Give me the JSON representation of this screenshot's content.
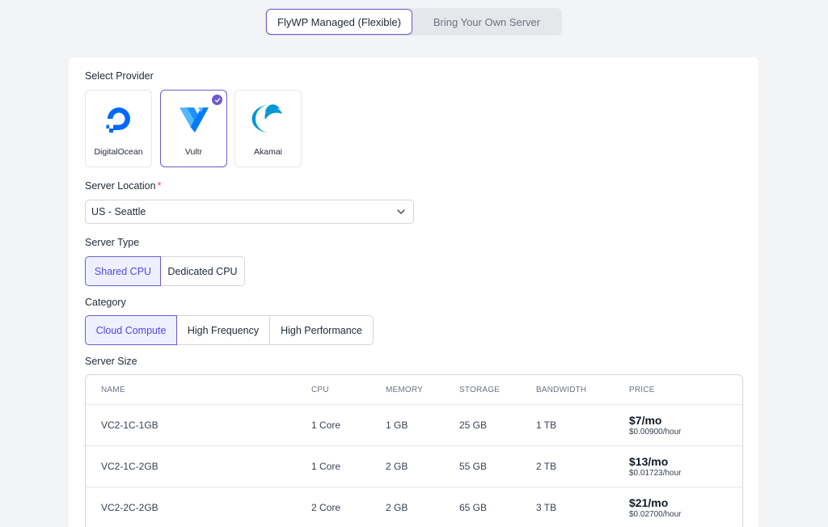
{
  "mode_toggle": {
    "managed_label": "FlyWP Managed (Flexible)",
    "byos_label": "Bring Your Own Server"
  },
  "provider": {
    "label": "Select Provider",
    "items": [
      {
        "name": "DigitalOcean",
        "icon": "digitalocean-logo-icon",
        "selected": false
      },
      {
        "name": "Vultr",
        "icon": "vultr-logo-icon",
        "selected": true
      },
      {
        "name": "Akamai",
        "icon": "akamai-logo-icon",
        "selected": false
      }
    ]
  },
  "location": {
    "label": "Server Location",
    "required_mark": "*",
    "value": "US - Seattle"
  },
  "server_type": {
    "label": "Server Type",
    "options": [
      "Shared CPU",
      "Dedicated CPU"
    ],
    "selected": "Shared CPU"
  },
  "category": {
    "label": "Category",
    "options": [
      "Cloud Compute",
      "High Frequency",
      "High Performance"
    ],
    "selected": "Cloud Compute"
  },
  "server_size": {
    "label": "Server Size",
    "columns": [
      "NAME",
      "CPU",
      "MEMORY",
      "STORAGE",
      "BANDWIDTH",
      "PRICE"
    ],
    "rows": [
      {
        "name": "VC2-1C-1GB",
        "cpu": "1 Core",
        "memory": "1 GB",
        "storage": "25 GB",
        "bandwidth": "1 TB",
        "price_month": "$7/mo",
        "price_hour": "$0.00900/hour"
      },
      {
        "name": "VC2-1C-2GB",
        "cpu": "1 Core",
        "memory": "2 GB",
        "storage": "55 GB",
        "bandwidth": "2 TB",
        "price_month": "$13/mo",
        "price_hour": "$0.01723/hour"
      },
      {
        "name": "VC2-2C-2GB",
        "cpu": "2 Core",
        "memory": "2 GB",
        "storage": "65 GB",
        "bandwidth": "3 TB",
        "price_month": "$21/mo",
        "price_hour": "$0.02700/hour"
      }
    ]
  },
  "colors": {
    "accent": "#6d5bd0",
    "page_bg": "#f3f4f6",
    "digitalocean_blue": "#0069ff",
    "vultr_blue": "#007bfc",
    "akamai_blue": "#0096d6"
  }
}
